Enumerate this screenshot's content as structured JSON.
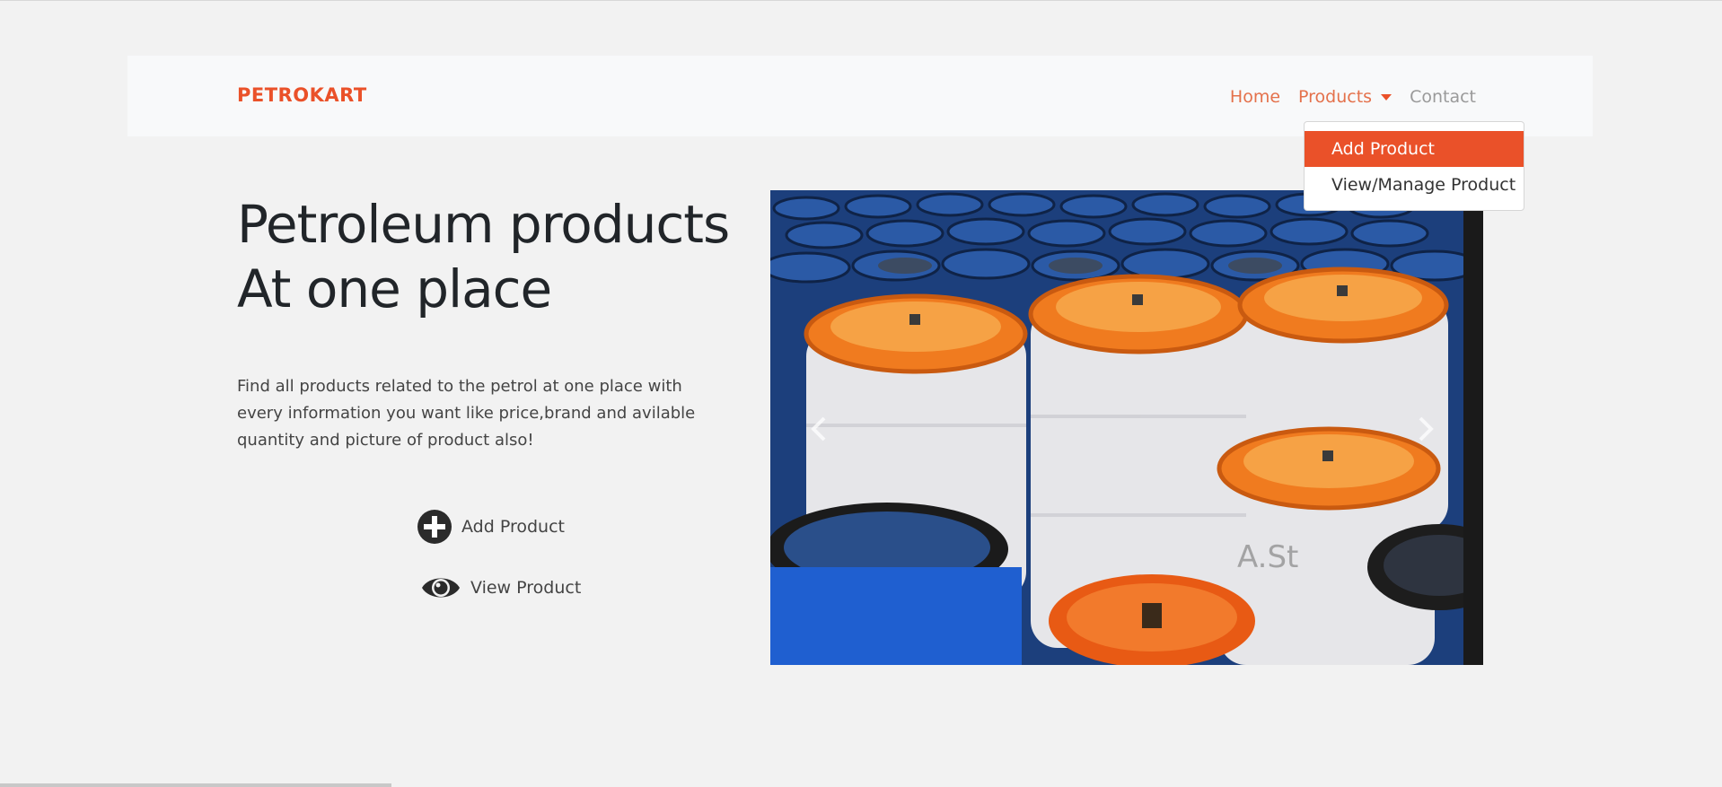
{
  "brand": "PETROKART",
  "nav": {
    "home": "Home",
    "products": "Products",
    "contact": "Contact"
  },
  "dropdown": {
    "items": [
      "Add Product",
      "View/Manage Product"
    ],
    "active_index": 0
  },
  "hero": {
    "title_line1": "Petroleum products",
    "title_line2": "At one place",
    "description": "Find all products related to the petrol at one place with every information you want like price,brand and avilable quantity and picture of product also!"
  },
  "actions": {
    "add_label": "Add Product",
    "view_label": "View Product"
  },
  "carousel": {
    "image_description": "orange and white barrels",
    "prev_icon": "chevron-left-icon",
    "next_icon": "chevron-right-icon"
  },
  "colors": {
    "accent": "#ea5129",
    "link": "#e4714b",
    "muted": "#9a9a9a",
    "background": "#f2f2f2",
    "navbar": "#f8f9fa"
  }
}
